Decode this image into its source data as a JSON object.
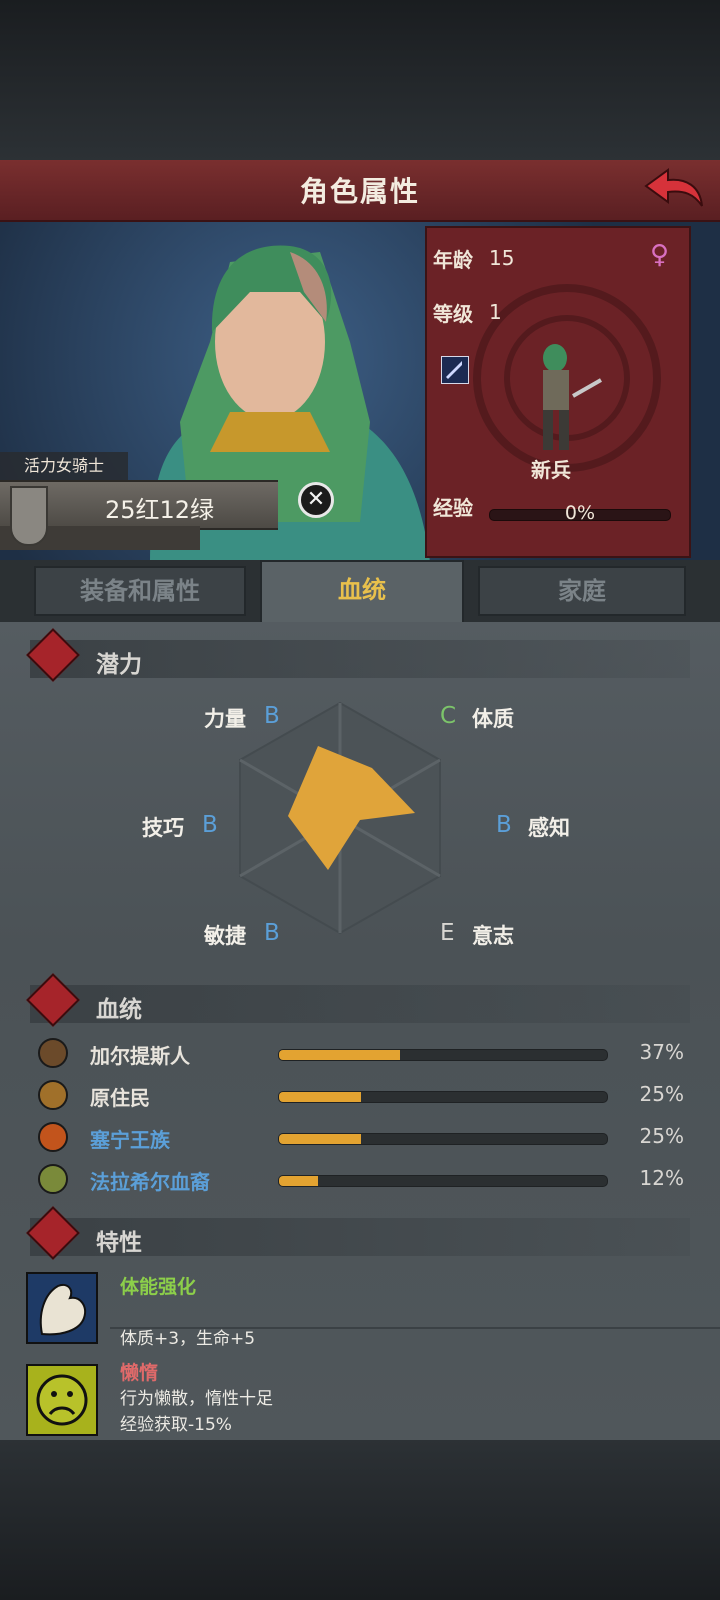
{
  "header": {
    "title": "角色属性"
  },
  "character": {
    "class_title": "活力女骑士",
    "name": "25红12绿",
    "age_label": "年龄",
    "age": "15",
    "level_label": "等级",
    "level": "1",
    "rank": "新兵",
    "exp_label": "经验",
    "exp_pct": "0%",
    "exp_fraction": 0
  },
  "tabs": [
    {
      "label": "装备和属性",
      "active": false
    },
    {
      "label": "血统",
      "active": true
    },
    {
      "label": "家庭",
      "active": false
    }
  ],
  "potential": {
    "title": "潜力",
    "attributes": [
      {
        "name": "力量",
        "grade": "B"
      },
      {
        "name": "体质",
        "grade": "C"
      },
      {
        "name": "感知",
        "grade": "B"
      },
      {
        "name": "意志",
        "grade": "E"
      },
      {
        "name": "敏捷",
        "grade": "B"
      },
      {
        "name": "技巧",
        "grade": "B"
      }
    ]
  },
  "bloodline": {
    "title": "血统",
    "items": [
      {
        "name": "加尔提斯人",
        "percent": 37,
        "pct_label": "37%",
        "color": "#e8e4dc"
      },
      {
        "name": "原住民",
        "percent": 25,
        "pct_label": "25%",
        "color": "#e8e4dc"
      },
      {
        "name": "塞宁王族",
        "percent": 25,
        "pct_label": "25%",
        "color": "#5b9fd8"
      },
      {
        "name": "法拉希尔血裔",
        "percent": 12,
        "pct_label": "12%",
        "color": "#5b9fd8"
      }
    ]
  },
  "traits": {
    "title": "特性",
    "items": [
      {
        "name": "体能强化",
        "color": "#8ccf4a",
        "desc1": "体质+3，生命+5",
        "desc2": ""
      },
      {
        "name": "懒惰",
        "color": "#e06a6a",
        "desc1": "行为懒散，惰性十足",
        "desc2": "经验获取-15%"
      }
    ]
  },
  "colors": {
    "accent_gold": "#e8c04c",
    "grade_blue": "#5b9fd8",
    "grade_green": "#7cc46a",
    "header_red": "#7a2f2f"
  }
}
